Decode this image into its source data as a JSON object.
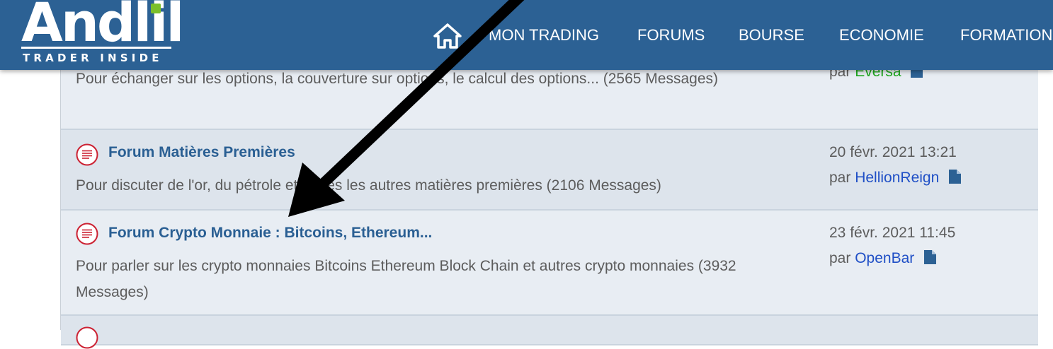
{
  "header": {
    "logo": {
      "wordmark": "Andlil",
      "tagline": "TRADER INSIDE"
    },
    "nav": [
      "MON TRADING",
      "FORUMS",
      "BOURSE",
      "ECONOMIE",
      "FORMATION"
    ]
  },
  "forums": [
    {
      "title": "",
      "description": "Pour échanger sur les options, la couverture sur options, le calcul des options... (2565 Messages)",
      "last_date": "",
      "last_by_prefix": "par",
      "last_user": "Eversa"
    },
    {
      "title": "Forum Matières Premières",
      "description": "Pour discuter de l'or, du pétrole et toutes les autres matières premières (2106 Messages)",
      "last_date": "20 févr. 2021 13:21",
      "last_by_prefix": "par",
      "last_user": "HellionReign"
    },
    {
      "title": "Forum Crypto Monnaie : Bitcoins, Ethereum...",
      "description": "Pour parler sur les crypto monnaies Bitcoins Ethereum Block Chain et autres crypto monnaies (3932 Messages)",
      "last_date": "23 févr. 2021 11:45",
      "last_by_prefix": "par",
      "last_user": "OpenBar"
    }
  ],
  "colors": {
    "header_bg": "#2c6194",
    "row_alt": "#dde4ec",
    "row_plain": "#e8edf3",
    "forum_title": "#2a5f93",
    "user_link": "#1f4fc6",
    "user_online": "#1fa81f",
    "forum_icon": "#cc2233",
    "logo_accent": "#7bbf2a"
  },
  "icons": {
    "home": "home-icon",
    "forum": "forum-unread-icon",
    "last_post": "document-icon",
    "annotation": "arrow-icon"
  }
}
